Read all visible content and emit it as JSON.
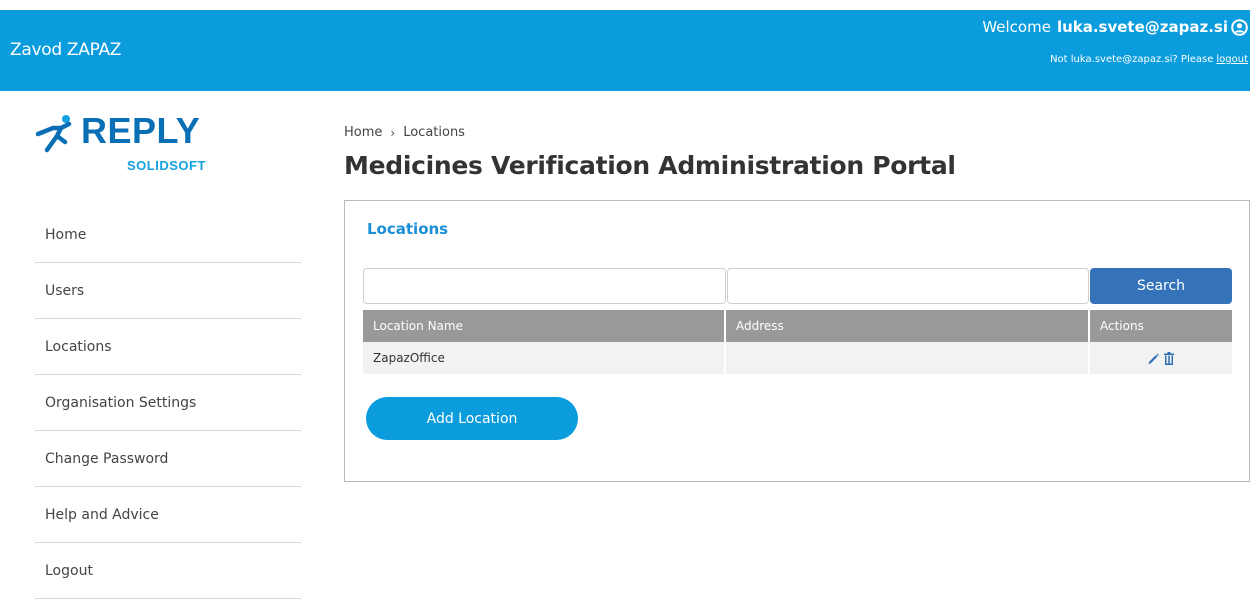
{
  "header": {
    "org_name": "Zavod ZAPAZ",
    "welcome_prefix": "Welcome",
    "user_email": "luka.svete@zapaz.si",
    "not_user_text": "Not luka.svete@zapaz.si?  Please",
    "logout_link": "logout",
    "bg_color": "#0a9cdc"
  },
  "logo": {
    "word": "REPLY",
    "sub": "SOLIDSOFT"
  },
  "sidebar": {
    "items": [
      {
        "label": "Home"
      },
      {
        "label": "Users"
      },
      {
        "label": "Locations"
      },
      {
        "label": "Organisation Settings"
      },
      {
        "label": "Change Password"
      },
      {
        "label": "Help and Advice"
      },
      {
        "label": "Logout"
      }
    ]
  },
  "breadcrumb": {
    "home": "Home",
    "separator": "›",
    "current": "Locations"
  },
  "page_title": "Medicines Verification Administration Portal",
  "panel": {
    "title": "Locations",
    "search_name_value": "",
    "search_address_value": "",
    "search_button": "Search",
    "table": {
      "columns": [
        "Location Name",
        "Address",
        "Actions"
      ],
      "rows": [
        {
          "name": "ZapazOffice",
          "address": "",
          "actions": [
            "edit-icon",
            "trash-icon"
          ]
        }
      ]
    },
    "add_button": "Add Location"
  }
}
